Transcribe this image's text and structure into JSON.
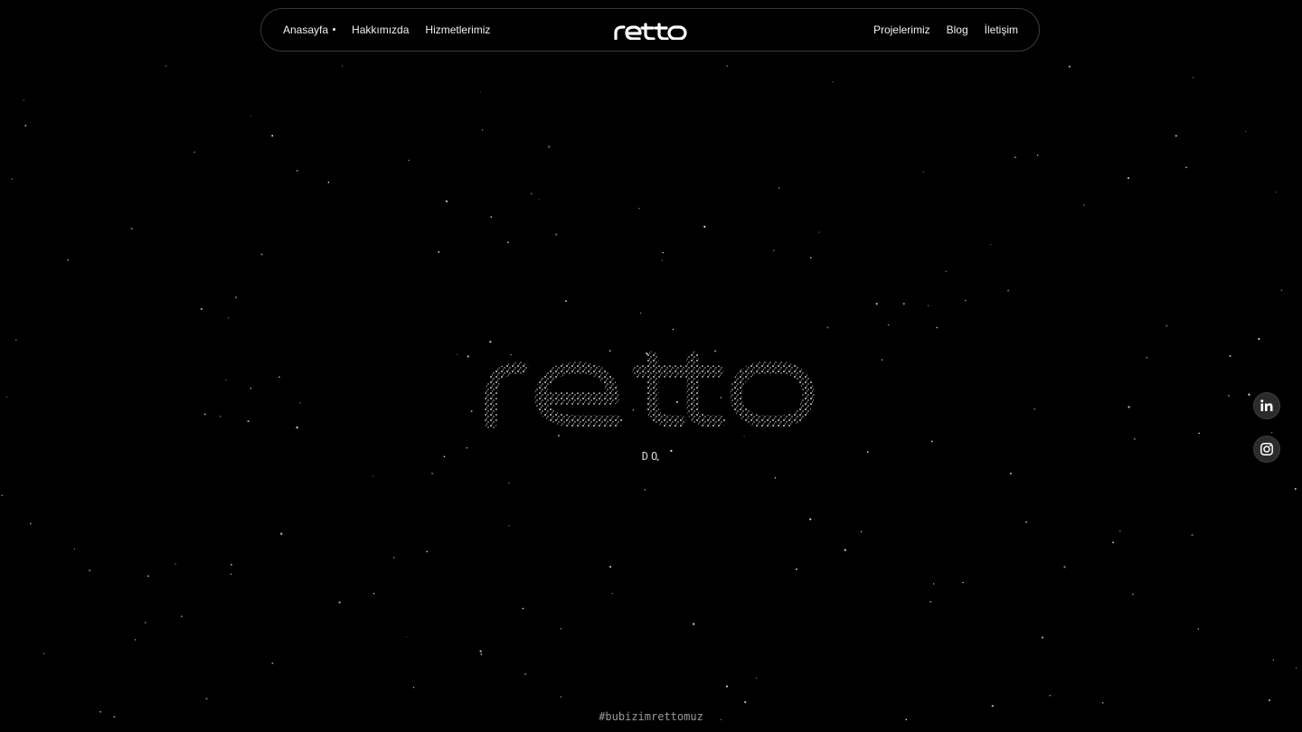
{
  "nav": {
    "left_items": [
      {
        "label": "Anasayfa",
        "active": true
      },
      {
        "label": "Hakkımızda"
      },
      {
        "label": "Hizmetlerimiz"
      }
    ],
    "right_items": [
      {
        "label": "Projelerimiz"
      },
      {
        "label": "Blog"
      },
      {
        "label": "İletişim"
      }
    ],
    "logo_text": "retto"
  },
  "hero": {
    "logo_text": "retto",
    "subtitle": "DO"
  },
  "footer": {
    "hashtag": "#bubizimrettomuz"
  },
  "social": [
    {
      "icon": "linkedin-icon"
    },
    {
      "icon": "instagram-icon"
    }
  ],
  "colors": {
    "background": "#000000",
    "text": "#ffffff",
    "nav_border": "#3a3a3a",
    "social_bg": "#2b2b2b"
  }
}
